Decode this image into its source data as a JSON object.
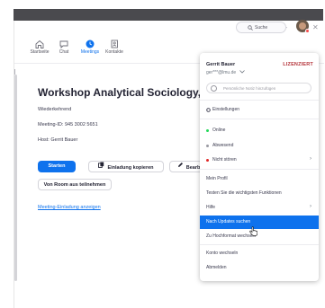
{
  "window": {
    "controls": {
      "minimize": "—",
      "maximize": "□",
      "close": "✕"
    }
  },
  "nav": {
    "items": [
      {
        "label": "Startseite",
        "icon": "home-icon",
        "active": false
      },
      {
        "label": "Chat",
        "icon": "chat-icon",
        "active": false
      },
      {
        "label": "Meetings",
        "icon": "clock-icon",
        "active": true
      },
      {
        "label": "Kontakte",
        "icon": "contacts-icon",
        "active": false
      }
    ],
    "search_label": "Suche"
  },
  "meeting": {
    "title": "Workshop Analytical Sociology, No",
    "recurring": "Wiederkehrend",
    "meeting_id": "Meeting-ID: 945 3002 5651",
    "host": "Host: Gerrit Bauer",
    "buttons": {
      "start": "Starten",
      "copy_invite": "Einladung kopieren",
      "edit": "Bearbeiten",
      "room": "Von Room aus teilnehmen"
    },
    "invite_link": "Meeting-Einladung anzeigen"
  },
  "profile_menu": {
    "name": "Gerrit Bauer",
    "license": "LIZENZIERT",
    "email": "ger***@lmu.de",
    "note_placeholder": "Persönliche Notiz hinzufügen",
    "items": [
      {
        "label": "Einstellungen",
        "icon": "gear-icon"
      },
      {
        "label": "Online",
        "status_color": "#23d959"
      },
      {
        "label": "Abwesend",
        "status_color": "#9a9aa2"
      },
      {
        "label": "Nicht stören",
        "status_color": "#e02828",
        "has_submenu": true
      },
      {
        "label": "Mein Profil"
      },
      {
        "label": "Testen Sie die wichtigsten Funktionen"
      },
      {
        "label": "Hilfe",
        "has_submenu": true
      },
      {
        "label": "Nach Updates suchen",
        "highlighted": true
      },
      {
        "label": "Zu Hochformat wechseln"
      },
      {
        "label": "Konto wechseln"
      },
      {
        "label": "Abmelden"
      }
    ]
  },
  "colors": {
    "accent": "#0e72ed",
    "license": "#b5363c"
  }
}
